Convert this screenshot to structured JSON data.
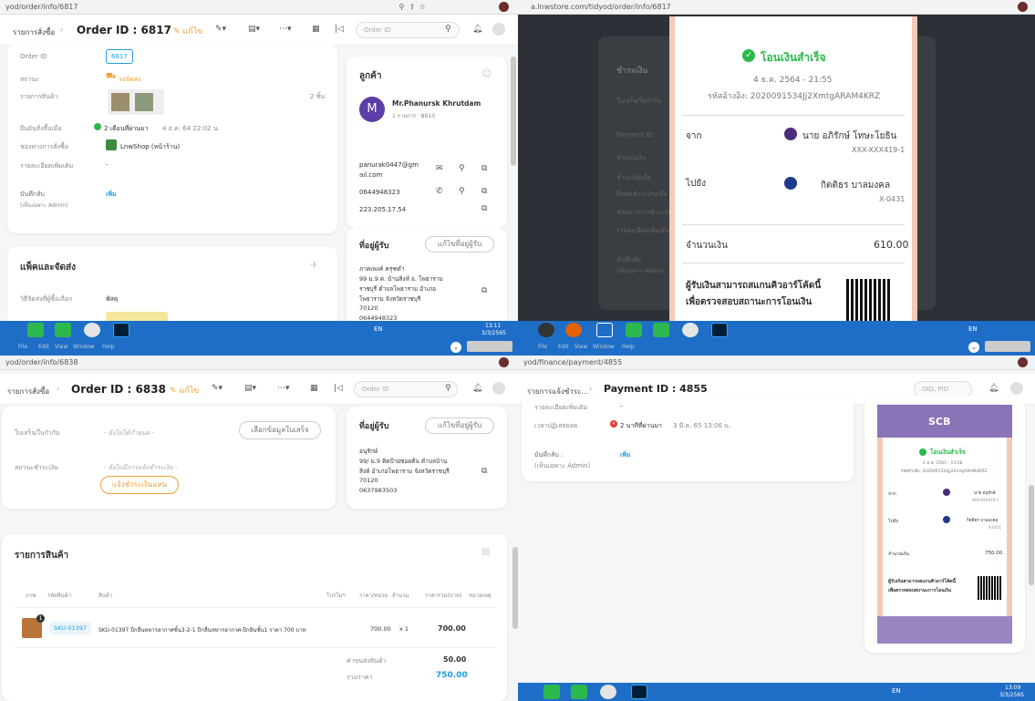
{
  "q1": {
    "url": "yod/order/info/6817",
    "breadcrumb": "รายการสั่งซื้อ",
    "title": "Order ID : 6817",
    "edit_label": "แก้ไข",
    "search_placeholder": "Order ID",
    "fields": {
      "order_id_label": "Order ID",
      "order_id_value": "6817",
      "status_label": "สถานะ",
      "status_value": "รอจัดส่ง",
      "items_label": "รายการสินค้า",
      "items_count": "2 ชิ้น",
      "confirm_label": "ยืนยันสั่งซื้อเมื่อ",
      "confirm_value": "2 เดือนที่ผ่านมา",
      "confirm_date": "4 ธ.ค. 64 22:02 น.",
      "channel_label": "ช่องทางการสั่งซื้อ",
      "channel_value": "LnwShop (หน้าร้าน)",
      "extra_label": "รายละเอียดเพิ่มเติม",
      "extra_value": "-",
      "note_label": "บันทึกลับ",
      "note_sub": "(เห็นเฉพาะ Admin)",
      "note_add": "เพิ่ม"
    },
    "customer": {
      "heading": "ลูกค้า",
      "avatar": "M",
      "name": "Mr.Phanursk Khrutdam",
      "sub": "1 รายการ · ฿610",
      "email_1": "panurak0447@gm",
      "email_2": "ail.com",
      "phone": "0644948323",
      "ip": "223.205.17.54"
    },
    "address": {
      "heading": "ที่อยู่ผู้รับ",
      "edit": "แก้ไขที่อยู่ผู้รับ",
      "lines": [
        "ภาคเพงค์ ครุฑดำ",
        "99 ม.9 ต. บ้านสิงห์ อ. โพธาราม",
        "ราชบุรี ตำบลโพธาราม อำเภอ",
        "โพธาราม จังหวัดราชบุรี",
        "70120",
        "0644948323"
      ]
    },
    "shipping": {
      "heading": "แพ็คและจัดส่ง",
      "method_label": "วิธีจัดส่งที่ผู้ซื้อเลือก",
      "method_value": "พัสดุ"
    },
    "taskbar": {
      "time": "13:11",
      "date": "3/3/2565",
      "lang": "EN"
    }
  },
  "q2": {
    "url": "a.lnwstore.com/tidyod/order/info/6817",
    "bg_heading": "ชำระเงิน",
    "bg_labels": [
      "ใบเสร็จ/ใบกำกับ",
      "Payment ID",
      "จำนวนเงิน",
      "ชำระเงินเมื่อ",
      "ยืนยันชำระเงินเมื่อ",
      "ช่องทางการชำระเงิน",
      "รายละเอียดเพิ่มเติม",
      "บันทึกลับ",
      "(เห็นเฉพาะ Admin)"
    ],
    "slip": {
      "status": "โอนเงินสำเร็จ",
      "datetime": "4 ธ.ค. 2564 - 21:55",
      "ref": "รหัสอ้างอิง: 2020091534Jj2XmtgARAM4KRZ",
      "from_label": "จาก",
      "from_name": "นาย อภิรักษ์ โทษะโยธิน",
      "from_acct": "XXX-XXX419-1",
      "to_label": "ไปยัง",
      "to_name": "กิตติธร บาลมงคล",
      "to_acct": "X-0431",
      "amount_label": "จำนวนเงิน",
      "amount": "610.00",
      "qr_text_1": "ผู้รับเงินสามารถสแกนคิวอาร์โค้ดนี้",
      "qr_text_2": "เพื่อตรวจสอบสถานะการโอนเงิน"
    },
    "taskbar": {
      "lang": "EN"
    }
  },
  "q3": {
    "menu": [
      "File",
      "Edit",
      "View",
      "Window",
      "Help"
    ],
    "url": "yod/order/info/6838",
    "breadcrumb": "รายการสั่งซื้อ",
    "title": "Order ID : 6838",
    "edit_label": "แก้ไข",
    "search_placeholder": "Order ID",
    "receipt_label": "ใบเสร็จ/ใบกำกับ",
    "receipt_value": "- ยังไม่ได้กำหนด -",
    "receipt_btn": "เลือกข้อมูลใบเสร็จ",
    "payment_label": "สถานะชำระเงิน",
    "payment_value": "- ยังไม่มีการแจ้งชำระเงิน -",
    "payment_btn": "แจ้งชำระเงินแทน",
    "address": {
      "heading": "ที่อยู่ผู้รับ",
      "edit": "แก้ไขที่อยู่ผู้รับ",
      "lines": [
        "อนุรักษ์",
        "99/ ม.9 ติดป้ายซอยต้น ตำบลบ้าน",
        "สิงห์ อำเภอโพธาราม จังหวัดราชบุรี",
        "70120",
        "0637983503"
      ]
    },
    "products": {
      "heading": "รายการสินค้า",
      "columns": [
        "ภาพ",
        "รหัสสินค้า",
        "สินค้า",
        "โปรโมฯ",
        "ราคา/หน่วย",
        "จำนวน",
        "ราคารวม(บาท)",
        "หมายเหตุ"
      ],
      "row": {
        "badge": "1",
        "sku": "SKU-01397",
        "name": "SKU-01397 ปีกลื่นหหารอากาศชั้น3-2-1 ปีกลื่นหหารอากาศ-ปีกอินชั้น1 ราคา 700 บาท",
        "unit_price": "700.00",
        "qty": "x 1",
        "total": "700.00"
      },
      "shipping_label": "ค่าขนส่งสินค้า",
      "shipping_value": "50.00",
      "sum_label": "รวมราคา",
      "sum_value": "750.00"
    }
  },
  "q4": {
    "menu": [
      "File",
      "Edit",
      "View",
      "Window",
      "Help"
    ],
    "url": "yod/finance/payment/4855",
    "breadcrumb": "รายการแจ้งชำระ...",
    "title": "Payment ID : 4855",
    "search_placeholder": "OID, PID",
    "extra_label": "รายละเอียดเพิ่มเติม",
    "extra_value": "-",
    "check_label": "เวลาปฏิเสธยอด",
    "check_value": "2 นาทีที่ผ่านมา",
    "check_date": "3 มี.ค. 65 13:06 น.",
    "note_label": "บันทึกลับ :",
    "note_sub": "(เห็นเฉพาะ Admin)",
    "note_add": "เพิ่ม",
    "slip": {
      "bank": "SCB",
      "status": "โอนเงินสำเร็จ",
      "datetime": "2 ม.ค. 2565 - 13:58",
      "ref": "รหัสอ้างอิง: 2020091534Jj2XmtgARAM4KRZ",
      "from_label": "จาก",
      "from_name": "นาย อนุรักษ์",
      "from_acct": "XXX-XXX419-1",
      "to_label": "ไปยัง",
      "to_name": "กิตติธร บาลมงคล",
      "to_acct": "X-0431",
      "amount_label": "จำนวนเงิน",
      "amount": "750.00",
      "qr_text_1": "ผู้รับเงินสามารถสแกนคิวอาร์โค้ดนี้",
      "qr_text_2": "เพื่อตรวจสอบสถานะการโอนเงิน"
    },
    "taskbar": {
      "time": "13:09",
      "date": "3/3/2565",
      "lang": "EN"
    }
  },
  "colors": {
    "accent": "#1ea0e0",
    "orange": "#f0a030",
    "taskbar": "#1e6ec8",
    "green": "#2db84d",
    "slip_bg": "#f5c9b8"
  }
}
